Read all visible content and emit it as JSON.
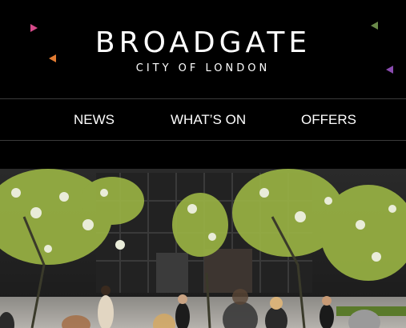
{
  "brand": {
    "name": "BROADGATE",
    "tagline": "CITY OF LONDON",
    "accent_colors": [
      "#d64a8a",
      "#e27b32",
      "#6a8a4a",
      "#8a4cb0"
    ]
  },
  "nav": {
    "items": [
      {
        "label": "NEWS"
      },
      {
        "label": "WHAT’S ON"
      },
      {
        "label": "OFFERS"
      }
    ]
  },
  "hero": {
    "icon": "photo-of-broadgate-plaza-with-blossom-trees-and-pedestrians"
  }
}
